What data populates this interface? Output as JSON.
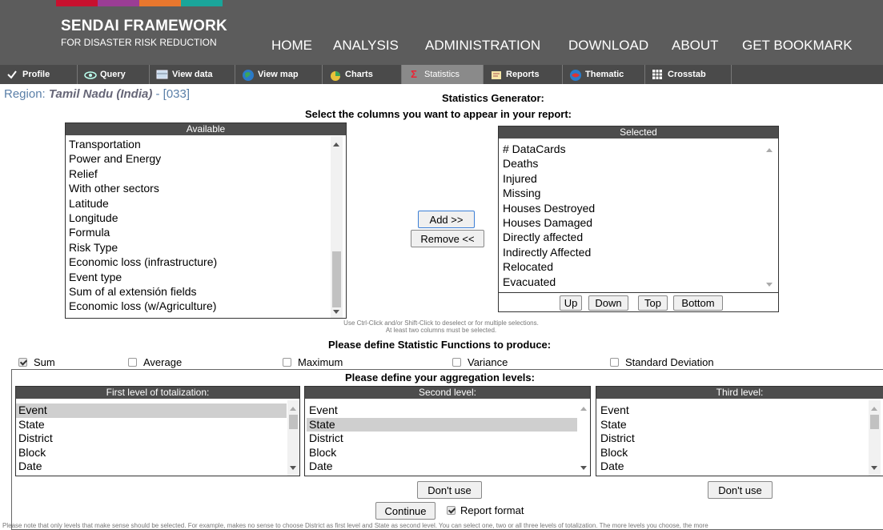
{
  "header": {
    "logo_line1": "SENDAI FRAMEWORK",
    "logo_line2": "FOR DISASTER RISK REDUCTION",
    "stripe_colors": [
      "#c8102e",
      "#9b3d95",
      "#e8772e",
      "#1aa59a"
    ],
    "bg_color": "#5c5c5c",
    "nav": [
      "HOME",
      "ANALYSIS",
      "ADMINISTRATION",
      "DOWNLOAD",
      "ABOUT",
      "GET BOOKMARK"
    ]
  },
  "tabs": [
    {
      "label": "Profile",
      "icon": "check-icon"
    },
    {
      "label": "Query",
      "icon": "eye-icon"
    },
    {
      "label": "View data",
      "icon": "table-data-icon"
    },
    {
      "label": "View map",
      "icon": "globe-icon"
    },
    {
      "label": "Charts",
      "icon": "chart-icon"
    },
    {
      "label": "Statistics",
      "icon": "sigma-icon",
      "active": true
    },
    {
      "label": "Reports",
      "icon": "reports-icon"
    },
    {
      "label": "Thematic",
      "icon": "thematic-icon"
    },
    {
      "label": "Crosstab",
      "icon": "grid-icon"
    }
  ],
  "region": {
    "prefix": "Region:",
    "name": "Tamil Nadu (India)",
    "code": "- [033]"
  },
  "generator_title": "Statistics Generator:",
  "select_prompt": "Select the columns you want to appear in your report:",
  "available": {
    "header": "Available",
    "items": [
      "Transportation",
      "Power and Energy",
      "Relief",
      "With other sectors",
      "Latitude",
      "Longitude",
      "Formula",
      "Risk Type",
      "Economic loss (infrastructure)",
      "Event type",
      "Sum of al extensión fields",
      "Economic loss (w/Agriculture)"
    ]
  },
  "selected": {
    "header": "Selected",
    "items": [
      "# DataCards",
      "Deaths",
      "Injured",
      "Missing",
      "Houses Destroyed",
      "Houses Damaged",
      "Directly affected",
      "Indirectly Affected",
      "Relocated",
      "Evacuated"
    ]
  },
  "buttons": {
    "add": "Add >>",
    "remove": "Remove <<",
    "up": "Up",
    "down": "Down",
    "top": "Top",
    "bottom": "Bottom",
    "dont_use": "Don't use",
    "continue": "Continue"
  },
  "selection_note": {
    "line1": "Use Ctrl-Click and/or Shift-Click to deselect or for multiple selections.",
    "line2": "At least two columns must be selected."
  },
  "functions_title": "Please define Statistic Functions to produce:",
  "functions": [
    {
      "label": "Sum",
      "checked": true
    },
    {
      "label": "Average",
      "checked": false
    },
    {
      "label": "Maximum",
      "checked": false
    },
    {
      "label": "Variance",
      "checked": false
    },
    {
      "label": "Standard Deviation",
      "checked": false
    }
  ],
  "aggregation": {
    "title": "Please define your aggregation levels:",
    "levels": [
      {
        "header": "First level of totalization:",
        "items": [
          "Event",
          "State",
          "District",
          "Block",
          "Date"
        ],
        "selected": "Event"
      },
      {
        "header": "Second level:",
        "items": [
          "Event",
          "State",
          "District",
          "Block",
          "Date"
        ],
        "selected": "State"
      },
      {
        "header": "Third level:",
        "items": [
          "Event",
          "State",
          "District",
          "Block",
          "Date"
        ],
        "selected": ""
      }
    ]
  },
  "report_format": {
    "label": "Report format",
    "checked": true
  },
  "bottom_note": "Please note that only levels that make sense should be selected. For example, makes no sense to choose District as first level and State as second level. You can select one, two or all three levels of totalization. The more levels you choose, the more"
}
